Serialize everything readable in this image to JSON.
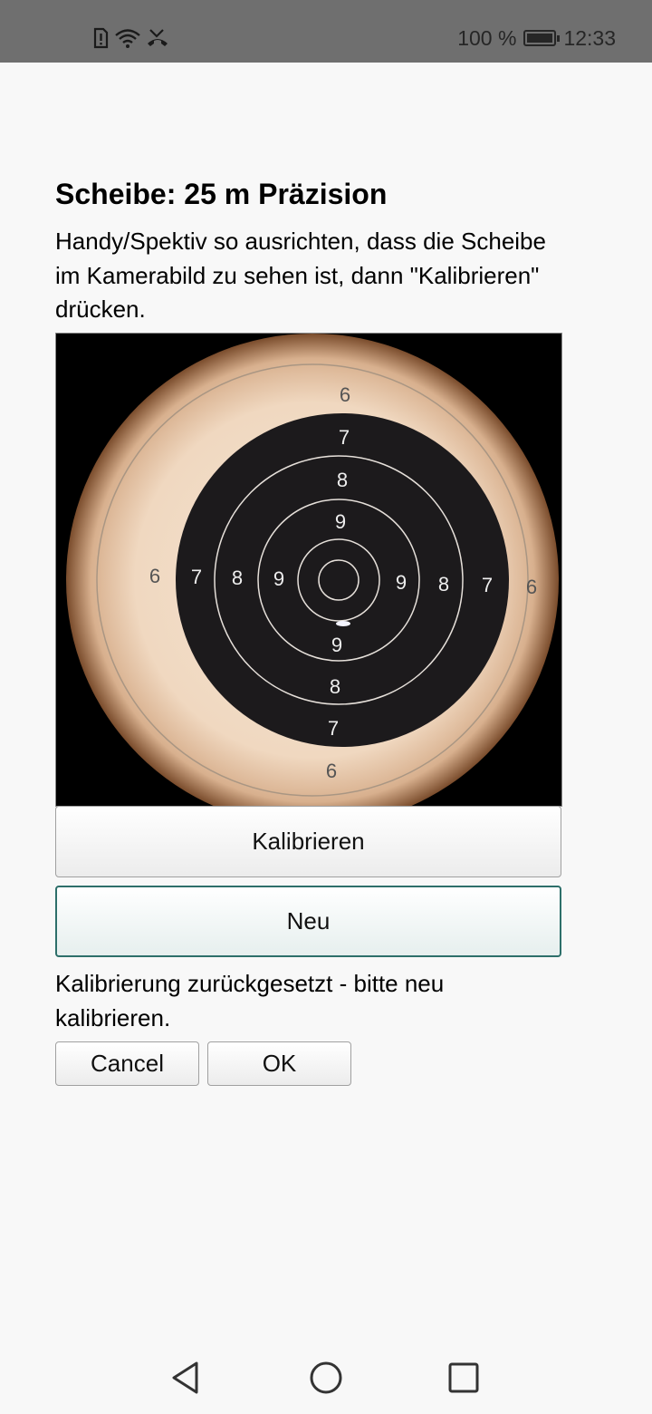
{
  "status_bar": {
    "battery_text": "100 %",
    "time": "12:33",
    "icons": [
      "sim-alert-icon",
      "wifi-icon",
      "missed-call-icon",
      "battery-charging-icon"
    ]
  },
  "dialog": {
    "title": "Scheibe: 25 m Präzision",
    "instructions": "Handy/Spektiv so ausrichten, dass die Scheibe im Kamerabild zu sehen ist, dann \"Kalibrieren\" drücken.",
    "calibrate_label": "Kalibrieren",
    "new_label": "Neu",
    "status_message": "Kalibrierung zurückgesetzt - bitte neu kalibrieren.",
    "cancel_label": "Cancel",
    "ok_label": "OK"
  },
  "target": {
    "ring_numbers": {
      "top": [
        "6",
        "7",
        "8",
        "9"
      ],
      "left": [
        "6",
        "7",
        "8",
        "9"
      ],
      "right": [
        "9",
        "8",
        "7",
        "6"
      ],
      "bottom": [
        "9",
        "8",
        "7",
        "6"
      ]
    }
  },
  "nav_bar": {
    "icons": [
      "back-icon",
      "home-icon",
      "recents-icon"
    ]
  }
}
